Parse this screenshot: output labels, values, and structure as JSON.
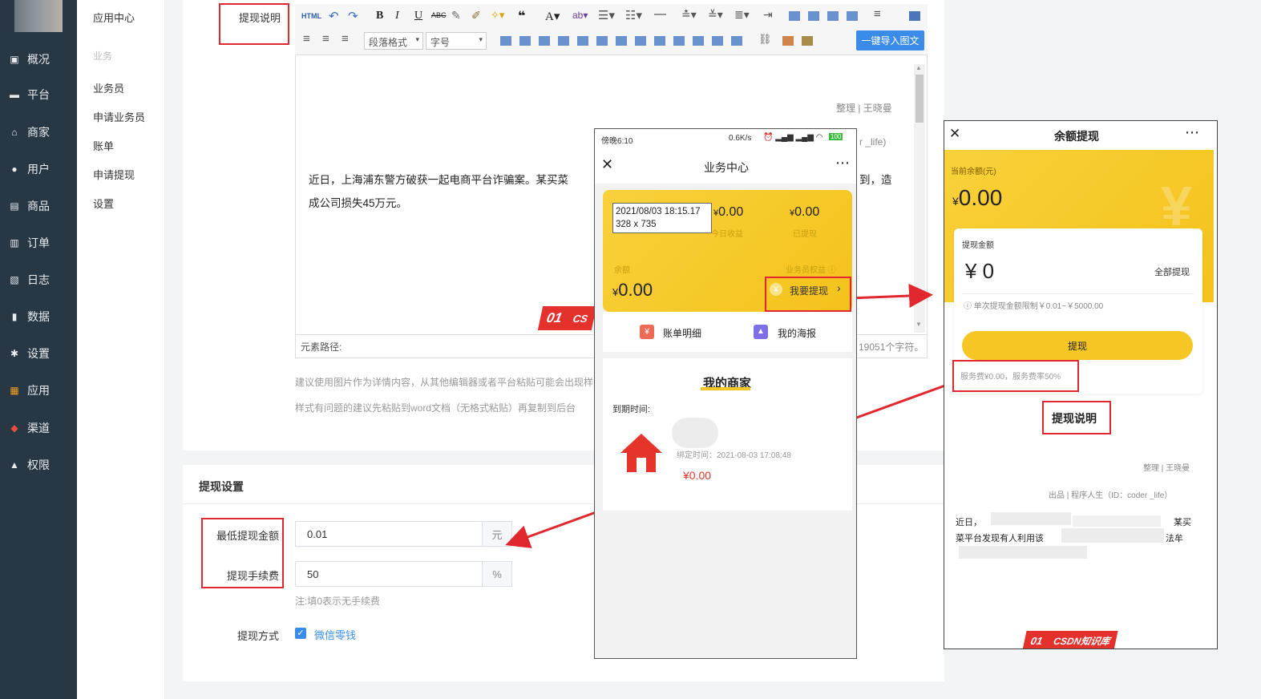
{
  "sidebar": {
    "items": [
      {
        "label": "概况",
        "icon": "dashboard-icon"
      },
      {
        "label": "平台",
        "icon": "monitor-icon"
      },
      {
        "label": "商家",
        "icon": "store-icon"
      },
      {
        "label": "用户",
        "icon": "user-icon"
      },
      {
        "label": "商品",
        "icon": "goods-icon"
      },
      {
        "label": "订单",
        "icon": "order-icon"
      },
      {
        "label": "日志",
        "icon": "log-icon"
      },
      {
        "label": "数据",
        "icon": "chart-icon"
      },
      {
        "label": "设置",
        "icon": "gear-icon"
      },
      {
        "label": "应用",
        "icon": "apps-icon"
      },
      {
        "label": "渠道",
        "icon": "cube-icon"
      },
      {
        "label": "权限",
        "icon": "lock-icon"
      }
    ]
  },
  "submenu": {
    "title": "应用中心",
    "group": "业务",
    "items": [
      "业务员",
      "申请业务员",
      "账单",
      "申请提现",
      "设置"
    ]
  },
  "editor": {
    "label": "提现说明",
    "toolbar_html": "HTML",
    "para_format": "段落格式",
    "font_size": "字号",
    "import_button": "一键导入图文",
    "byline": "整理 | 王晓曼",
    "byline2": "r _life)",
    "body_line1": "近日，上海浦东警方破获一起电商平台诈骗案。某买菜",
    "body_line1_end": "到，造",
    "body_line2": "成公司损失45万元。",
    "element_path": "元素路径:",
    "char_count": "19051个字符。",
    "hint1": "建议使用图片作为详情内容，从其他编辑器或者平台粘贴可能会出现样",
    "hint2": "样式有问题的建议先粘贴到word文档（无格式粘贴）再复制到后台",
    "watermark_num": "01",
    "watermark_text": "CS"
  },
  "withdraw_settings": {
    "section_title": "提现设置",
    "min_label": "最低提现金额",
    "min_value": "0.01",
    "min_unit": "元",
    "fee_label": "提现手续费",
    "fee_value": "50",
    "fee_unit": "%",
    "fee_hint": "注:填0表示无手续费",
    "method_label": "提现方式",
    "method_option": "微信零钱",
    "method_checked": true
  },
  "phone1": {
    "status_time": "傍晚6:10",
    "status_right": "0.6K/s",
    "battery": "100",
    "title": "业务中心",
    "tooltip_line1": "2021/08/03 18:15.17",
    "tooltip_line2": "328 x 735",
    "today_amount": "0.00",
    "today_label": "今日收益",
    "withdrawn_amount": "0.00",
    "withdrawn_label": "已提现",
    "balance_label": "余额",
    "rights_label": "业务员权益",
    "balance_amount": "0.00",
    "currency": "¥",
    "withdraw_btn": "我要提现",
    "bill_label": "账单明细",
    "poster_label": "我的海报",
    "merchants_title": "我的商家",
    "expire_label": "到期时间:",
    "bind_time": "绑定时间：2021-08-03 17:08:48",
    "merchant_amount": "¥0.00"
  },
  "phone2": {
    "title": "余额提现",
    "balance_label": "当前余额(元)",
    "currency": "¥",
    "balance_amount": "0.00",
    "amount_label": "提现金额",
    "amount_value": "¥ 0",
    "all_label": "全部提现",
    "limit_note": "单次提现金额限制￥0.01~￥5000.00",
    "submit_button": "提现",
    "fee_note": "服务费¥0.00，服务费率50%",
    "desc_title": "提现说明",
    "byline": "整理 | 王晓曼",
    "byline2": "出品 | 程序人生（ID：coder _life）",
    "body_1": "近日，",
    "body_1b": "某买",
    "body_2": "菜平台发现有人利用该",
    "body_2b": "法牟",
    "watermark_num": "01",
    "watermark_text": "CSDN知识库"
  },
  "colors": {
    "accent_red": "#e0282e",
    "sidebar": "#283744",
    "yellow": "#f6c624",
    "blue": "#3b8ce8"
  }
}
